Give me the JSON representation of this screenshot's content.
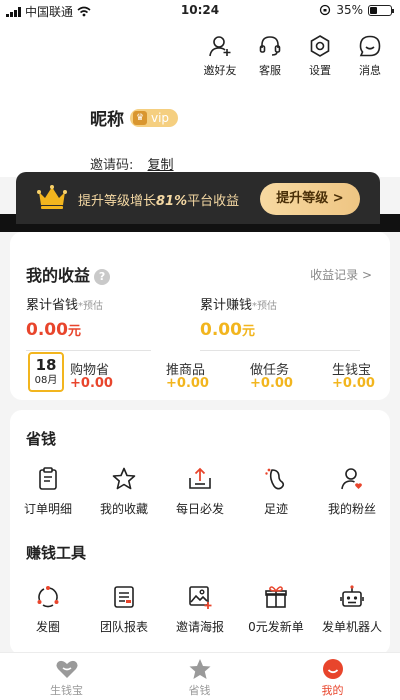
{
  "status_bar": {
    "carrier": "中国联通",
    "time": "10:24",
    "battery": "35%",
    "battery_level": 0.35
  },
  "header": {
    "actions": [
      {
        "label": "邀好友",
        "icon": "add-user-icon"
      },
      {
        "label": "客服",
        "icon": "headset-icon"
      },
      {
        "label": "设置",
        "icon": "gear-icon"
      },
      {
        "label": "消息",
        "icon": "message-icon"
      }
    ],
    "nickname": "昵称",
    "vip_label": "vip",
    "invite_label": "邀请码:",
    "copy_label": "复制"
  },
  "banner": {
    "text_pre": "提升等级增长",
    "text_percent": "81%",
    "text_post": "平台收益",
    "button": "提升等级 >"
  },
  "earnings": {
    "title": "我的收益",
    "help": "?",
    "records": "收益记录 >",
    "saved_label": "累计省钱",
    "saved_note": "*预估",
    "saved_value": "0.00",
    "earned_label": "累计赚钱",
    "earned_note": "*预估",
    "earned_value": "0.00",
    "currency": "元",
    "calendar_day": "18",
    "calendar_month": "08月",
    "items": [
      {
        "label": "购物省",
        "value": "+0.00"
      },
      {
        "label": "推商品",
        "value": "+0.00"
      },
      {
        "label": "做任务",
        "value": "+0.00"
      },
      {
        "label": "生钱宝",
        "value": "+0.00"
      }
    ]
  },
  "save_section": {
    "title": "省钱",
    "items": [
      {
        "label": "订单明细",
        "icon": "clipboard-icon"
      },
      {
        "label": "我的收藏",
        "icon": "star-icon"
      },
      {
        "label": "每日必发",
        "icon": "share-box-icon"
      },
      {
        "label": "足迹",
        "icon": "footprint-icon"
      },
      {
        "label": "我的粉丝",
        "icon": "fans-icon"
      }
    ]
  },
  "earn_section": {
    "title": "赚钱工具",
    "items": [
      {
        "label": "发圈",
        "icon": "circle-share-icon"
      },
      {
        "label": "团队报表",
        "icon": "report-icon"
      },
      {
        "label": "邀请海报",
        "icon": "poster-icon"
      },
      {
        "label": "0元发新单",
        "icon": "gift-icon"
      },
      {
        "label": "发单机器人",
        "icon": "robot-icon"
      }
    ]
  },
  "tabbar": [
    {
      "label": "生钱宝",
      "icon": "heart-tab-icon"
    },
    {
      "label": "省钱",
      "icon": "star-tab-icon"
    },
    {
      "label": "我的",
      "icon": "smile-tab-icon"
    }
  ],
  "colors": {
    "accent_red": "#e8452c",
    "accent_gold": "#f2b51e",
    "banner_bg": "#2b2b2b",
    "banner_text": "#f4d8a3"
  }
}
